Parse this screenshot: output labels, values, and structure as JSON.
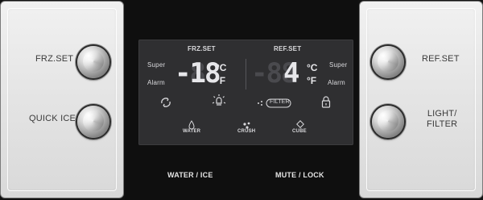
{
  "left_panel": {
    "frz_set_label": "FRZ.SET",
    "quick_ice_label": "QUICK ICE"
  },
  "right_panel": {
    "ref_set_label": "REF.SET",
    "light_filter_label_line1": "LIGHT/",
    "light_filter_label_line2": "FILTER"
  },
  "display": {
    "frz_title": "FRZ.SET",
    "ref_title": "REF.SET",
    "frz_super": "Super",
    "frz_alarm": "Alarm",
    "ref_super": "Super",
    "ref_alarm": "Alarm",
    "frz_ghost_digits": "-88",
    "frz_digits": "-18",
    "frz_unit_c": "°C",
    "frz_unit_f": "°F",
    "ref_ghost_digits": "-88",
    "ref_digits": "4",
    "ref_unit_c": "°C",
    "ref_unit_f": "°F",
    "filter_label": "FILTER",
    "water_label": "WATER",
    "crush_label": "CRUSH",
    "cube_label": "CUBE"
  },
  "bottom": {
    "water_ice_label": "WATER / ICE",
    "mute_lock_label": "MUTE / LOCK"
  },
  "icons": [
    "spin-icon",
    "light-bulb-icon",
    "filter-icon",
    "lock-icon",
    "water-drop-icon",
    "crush-ice-icon",
    "cube-ice-icon"
  ]
}
